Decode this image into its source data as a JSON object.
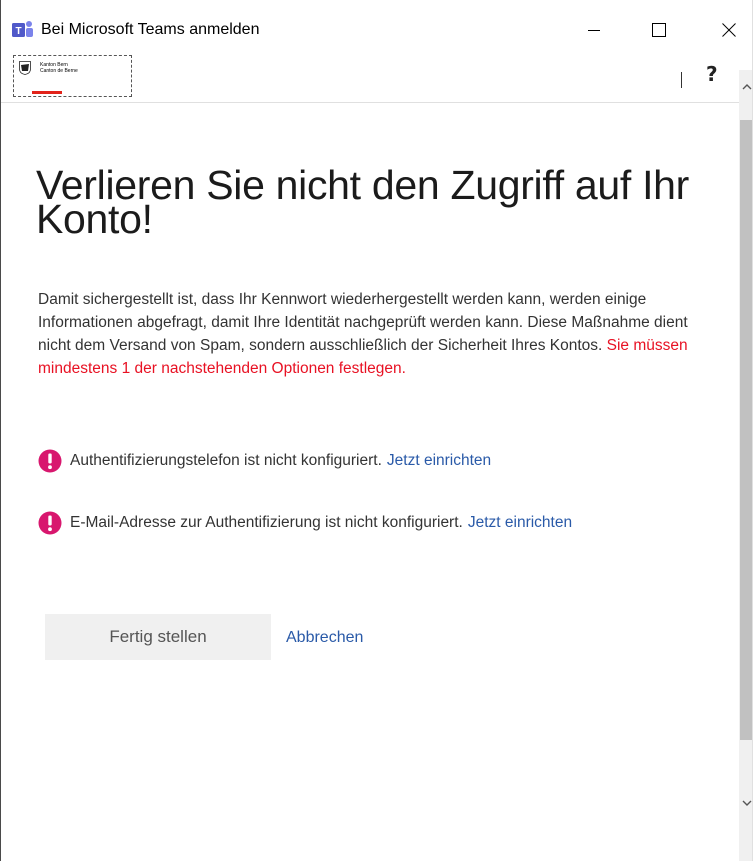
{
  "window": {
    "title": "Bei Microsoft Teams anmelden",
    "app_icon": "teams-icon",
    "controls": {
      "minimize": "minimize-icon",
      "maximize": "maximize-icon",
      "close": "close-icon"
    }
  },
  "header": {
    "logo_line1": "Kanton Bern",
    "logo_line2": "Canton de Berne",
    "help_label": "?"
  },
  "main": {
    "heading": "Verlieren Sie nicht den Zugriff auf Ihr Konto!",
    "intro": "Damit sichergestellt ist, dass Ihr Kennwort wiederhergestellt werden kann, werden einige Informationen abgefragt, damit Ihre Identität nachgeprüft werden kann. Diese Maßnahme dient nicht dem Versand von Spam, sondern ausschließlich der Sicherheit Ihres Kontos.",
    "intro_required": "Sie müssen mindestens 1 der nachstehenden Optionen festlegen.",
    "items": [
      {
        "status": "Authentifizierungstelefon ist nicht konfiguriert.",
        "link": "Jetzt einrichten"
      },
      {
        "status": "E-Mail-Adresse zur Authentifizierung ist nicht konfiguriert.",
        "link": "Jetzt einrichten"
      }
    ],
    "finish_label": "Fertig stellen",
    "cancel_label": "Abbrechen"
  },
  "colors": {
    "required_text": "#e81123",
    "alert_icon": "#d8176e",
    "link": "#2a5aa8"
  }
}
